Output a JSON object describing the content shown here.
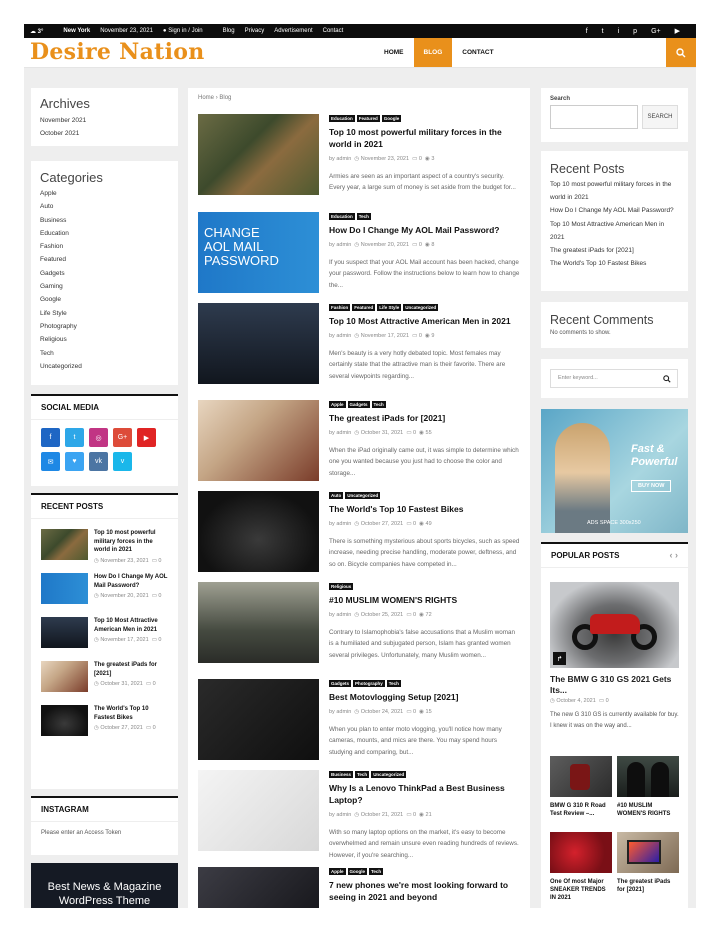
{
  "topbar": {
    "weather": "3°",
    "city": "New York",
    "date": "November 23, 2021",
    "signin": "Sign in / Join",
    "links": [
      "Blog",
      "Privacy",
      "Advertisement",
      "Contact"
    ],
    "social": [
      "f",
      "t",
      "i",
      "p",
      "G+",
      "▶"
    ]
  },
  "header": {
    "logo": "Desire Nation",
    "nav": [
      "HOME",
      "BLOG",
      "CONTACT"
    ],
    "active": "BLOG"
  },
  "colors": {
    "accent": "#e9901b",
    "dark": "#0d0d0d"
  },
  "breadcrumb": {
    "home": "Home",
    "sep": "›",
    "current": "Blog"
  },
  "left": {
    "archives": {
      "title": "Archives",
      "items": [
        "November 2021",
        "October 2021"
      ]
    },
    "categories": {
      "title": "Categories",
      "items": [
        "Apple",
        "Auto",
        "Business",
        "Education",
        "Fashion",
        "Featured",
        "Gadgets",
        "Gaming",
        "Google",
        "Life Style",
        "Photography",
        "Religious",
        "Tech",
        "Uncategorized"
      ]
    },
    "social": {
      "title": "SOCIAL MEDIA",
      "icons": [
        {
          "label": "f",
          "color": "#1e66c4"
        },
        {
          "label": "t",
          "color": "#2ea7e8"
        },
        {
          "label": "◎",
          "color": "#c13584"
        },
        {
          "label": "G+",
          "color": "#dd4b39"
        },
        {
          "label": "▶",
          "color": "#e02424"
        },
        {
          "label": "✉",
          "color": "#1e88e5"
        },
        {
          "label": "♥",
          "color": "#3ba4f2"
        },
        {
          "label": "vk",
          "color": "#4c75a3"
        },
        {
          "label": "v",
          "color": "#1ab7ea"
        }
      ]
    },
    "recent_posts": {
      "title": "RECENT POSTS",
      "items": [
        {
          "title": "Top 10 most powerful military forces in the world in 2021",
          "date": "November 23, 2021",
          "comments": "0"
        },
        {
          "title": "How Do I Change My AOL Mail Password?",
          "date": "November 20, 2021",
          "comments": "0"
        },
        {
          "title": "Top 10 Most Attractive American Men in 2021",
          "date": "November 17, 2021",
          "comments": "0"
        },
        {
          "title": "The greatest iPads for [2021]",
          "date": "October 31, 2021",
          "comments": "0"
        },
        {
          "title": "The World's Top 10 Fastest Bikes",
          "date": "October 27, 2021",
          "comments": "0"
        }
      ]
    },
    "instagram": {
      "title": "INSTAGRAM",
      "text": "Please enter an Access Token"
    },
    "promo": {
      "text": "Best News & Magazine WordPress Theme"
    }
  },
  "posts": [
    {
      "tags": [
        "Education",
        "Featured",
        "Google"
      ],
      "title": "Top 10 most powerful military forces in the world in 2021",
      "author": "admin",
      "date": "November 23, 2021",
      "comments": "0",
      "views": "3",
      "excerpt": "Armies are seen as an important aspect of a country's security. Every year, a large sum of money is set aside from the budget for..."
    },
    {
      "tags": [
        "Education",
        "Tech"
      ],
      "title": "How Do I Change My AOL Mail Password?",
      "author": "admin",
      "date": "November 20, 2021",
      "comments": "0",
      "views": "8",
      "excerpt": "If you suspect that your AOL Mail account has been hacked, change your password. Follow the instructions below to learn how to change the..."
    },
    {
      "tags": [
        "Fashion",
        "Featured",
        "Life Style",
        "Uncategorized"
      ],
      "title": "Top 10 Most Attractive American Men in 2021",
      "author": "admin",
      "date": "November 17, 2021",
      "comments": "0",
      "views": "9",
      "excerpt": "Men's beauty is a very hotly debated topic. Most females may certainly state that the attractive man is their favorite. There are several viewpoints regarding..."
    },
    {
      "tags": [
        "Apple",
        "Gadgets",
        "Tech"
      ],
      "title": "The greatest iPads for [2021]",
      "author": "admin",
      "date": "October 31, 2021",
      "comments": "0",
      "views": "55",
      "excerpt": "When the iPad originally came out, it was simple to determine which one you wanted because you just had to choose the color and storage..."
    },
    {
      "tags": [
        "Auto",
        "Uncategorized"
      ],
      "title": "The World's Top 10 Fastest Bikes",
      "author": "admin",
      "date": "October 27, 2021",
      "comments": "0",
      "views": "49",
      "excerpt": "There is something mysterious about sports bicycles, such as speed increase, needing precise handling, moderate power, deftness, and so on. Bicycle companies have competed in..."
    },
    {
      "tags": [
        "Religious"
      ],
      "title": "#10 MUSLIM WOMEN'S RIGHTS",
      "author": "admin",
      "date": "October 25, 2021",
      "comments": "0",
      "views": "72",
      "excerpt": "Contrary to Islamophobia's false accusations that a Muslim woman is a humiliated and subjugated person, Islam has granted women several privileges. Unfortunately, many Muslim women..."
    },
    {
      "tags": [
        "Gadgets",
        "Photography",
        "Tech"
      ],
      "title": "Best Motovlogging Setup [2021]",
      "author": "admin",
      "date": "October 24, 2021",
      "comments": "0",
      "views": "15",
      "excerpt": "When you plan to enter moto vlogging, you'll notice how many cameras, mounts, and mics are there. You may spend hours studying and comparing, but..."
    },
    {
      "tags": [
        "Business",
        "Tech",
        "Uncategorized"
      ],
      "title": "Why Is a Lenovo ThinkPad a Best Business Laptop?",
      "author": "admin",
      "date": "October 21, 2021",
      "comments": "0",
      "views": "21",
      "excerpt": "With so many laptop options on the market, it's easy to become overwhelmed and remain unsure even reading hundreds of reviews. However, if you're searching..."
    },
    {
      "tags": [
        "Apple",
        "Google",
        "Tech"
      ],
      "title": "7 new phones we're most looking forward to seeing in 2021 and beyond",
      "author": "admin",
      "date": "",
      "comments": "",
      "views": "",
      "excerpt": ""
    }
  ],
  "right": {
    "search": {
      "label": "Search",
      "button": "SEARCH"
    },
    "recent_posts": {
      "title": "Recent Posts",
      "items": [
        "Top 10 most powerful military forces in the world in 2021",
        "How Do I Change My AOL Mail Password?",
        "Top 10 Most Attractive American Men in 2021",
        "The greatest iPads for [2021]",
        "The World's Top 10 Fastest Bikes"
      ]
    },
    "recent_comments": {
      "title": "Recent Comments",
      "text": "No comments to show."
    },
    "keyword": {
      "placeholder": "Enter keyword..."
    },
    "ad": {
      "line1": "Fast &",
      "line2": "Powerful",
      "button": "BUY NOW",
      "caption": "ADS SPACE 300x250"
    },
    "popular": {
      "title": "POPULAR POSTS",
      "main_title": "The BMW G 310 GS 2021 Gets Its...",
      "date": "October 4, 2021",
      "comments": "0",
      "excerpt": "The new G 310 GS is currently available for buy. I knew it was on the way and...",
      "grid": [
        "BMW G 310 R Road Test Review –...",
        "#10 MUSLIM WOMEN'S RIGHTS",
        "One Of most Major SNEAKER TRENDS IN 2021",
        "The greatest iPads for [2021]"
      ]
    }
  },
  "post_meta_labels": {
    "by": "by",
    "clock": "◷",
    "comment": "▭",
    "eye": "◉"
  }
}
